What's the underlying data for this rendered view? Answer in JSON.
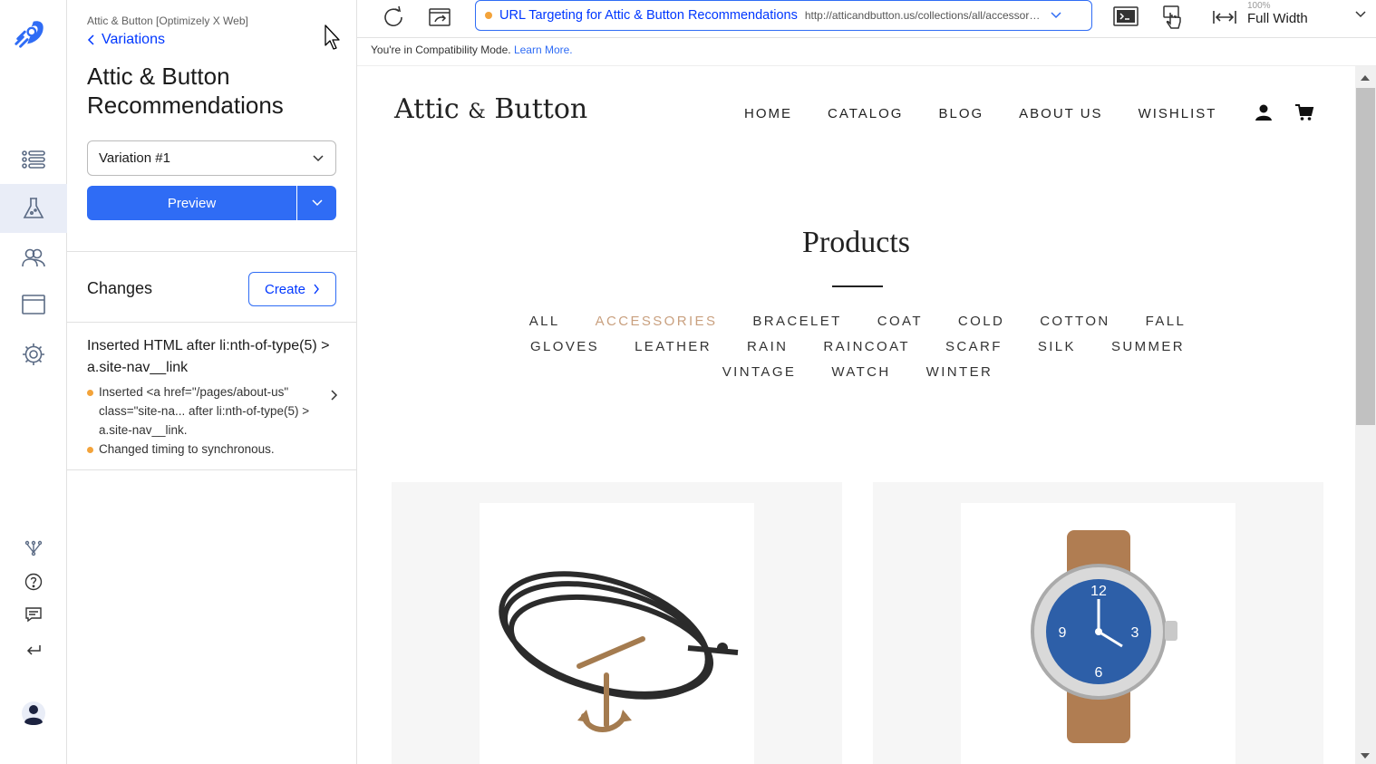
{
  "colors": {
    "accent": "#2f6cf5",
    "link": "#0037ff",
    "status_dot": "#f3a33a",
    "active_tag": "#c9a07f"
  },
  "rail": {
    "icons": [
      "optimizely-logo-icon",
      "list-icon",
      "flask-icon",
      "audiences-icon",
      "window-icon",
      "gear-icon",
      "network-icon",
      "help-icon",
      "feedback-icon",
      "exit-icon",
      "user-avatar-icon"
    ],
    "active": "flask-icon"
  },
  "panel": {
    "breadcrumb": "Attic & Button [Optimizely X Web]",
    "back_label": "Variations",
    "title": "Attic & Button Recommendations",
    "variation_selected": "Variation #1",
    "preview_label": "Preview",
    "changes_heading": "Changes",
    "create_label": "Create",
    "change": {
      "title": "Inserted HTML after li:nth-of-type(5) > a.site-nav__link",
      "details": [
        "Inserted <a href=\"/pages/about-us\" class=\"site-na... after li:nth-of-type(5) > a.site-nav__link.",
        "Changed timing to synchronous."
      ]
    }
  },
  "toolbar": {
    "page_name": "URL Targeting for Attic & Button Recommendations",
    "page_url": "http://atticandbutton.us/collections/all/accessories",
    "zoom_percent": "100%",
    "zoom_mode": "Full Width"
  },
  "compat": {
    "text": "You're in Compatibility Mode.",
    "link": "Learn More."
  },
  "site": {
    "logo_left": "Attic",
    "logo_amp": "&",
    "logo_right": "Button",
    "nav": [
      "HOME",
      "CATALOG",
      "BLOG",
      "ABOUT US",
      "WISHLIST"
    ],
    "heading": "Products",
    "tags": [
      "ALL",
      "ACCESSORIES",
      "BRACELET",
      "COAT",
      "COLD",
      "COTTON",
      "FALL",
      "GLOVES",
      "LEATHER",
      "RAIN",
      "RAINCOAT",
      "SCARF",
      "SILK",
      "SUMMER",
      "VINTAGE",
      "WATCH",
      "WINTER"
    ],
    "active_tag": "ACCESSORIES",
    "products": [
      "anchor-bracelet",
      "leather-strap-watch"
    ]
  }
}
